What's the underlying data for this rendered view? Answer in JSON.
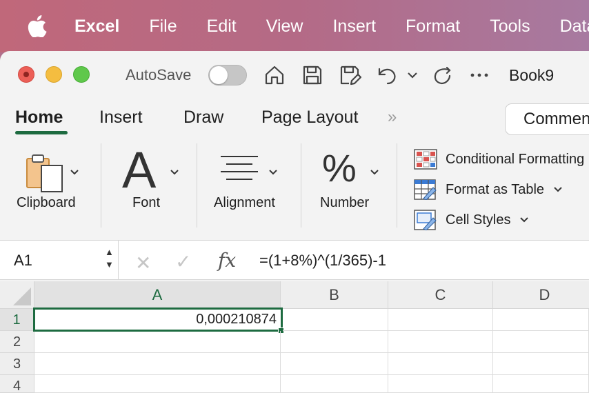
{
  "menubar": {
    "app_name": "Excel",
    "items": [
      "File",
      "Edit",
      "View",
      "Insert",
      "Format",
      "Tools",
      "Data"
    ]
  },
  "titlebar": {
    "autosave_label": "AutoSave",
    "autosave_on": false,
    "document_title": "Book9"
  },
  "tabs": {
    "home": "Home",
    "insert": "Insert",
    "draw": "Draw",
    "page_layout": "Page Layout",
    "more": "»",
    "comments": "Comments"
  },
  "ribbon": {
    "clipboard": "Clipboard",
    "font": "Font",
    "font_glyph": "A",
    "alignment": "Alignment",
    "number": "Number",
    "number_glyph": "%",
    "conditional_formatting": "Conditional Formatting",
    "format_as_table": "Format as Table",
    "cell_styles": "Cell Styles"
  },
  "formula_bar": {
    "name_box": "A1",
    "fx": "fx",
    "formula": "=(1+8%)^(1/365)-1"
  },
  "sheet": {
    "columns": [
      "A",
      "B",
      "C",
      "D"
    ],
    "rows": [
      "1",
      "2",
      "3",
      "4"
    ],
    "active_cell": "A1",
    "cells": {
      "A1": "0,000210874"
    }
  },
  "colors": {
    "accent": "#1d6b40",
    "menubar": "#b46a86"
  }
}
